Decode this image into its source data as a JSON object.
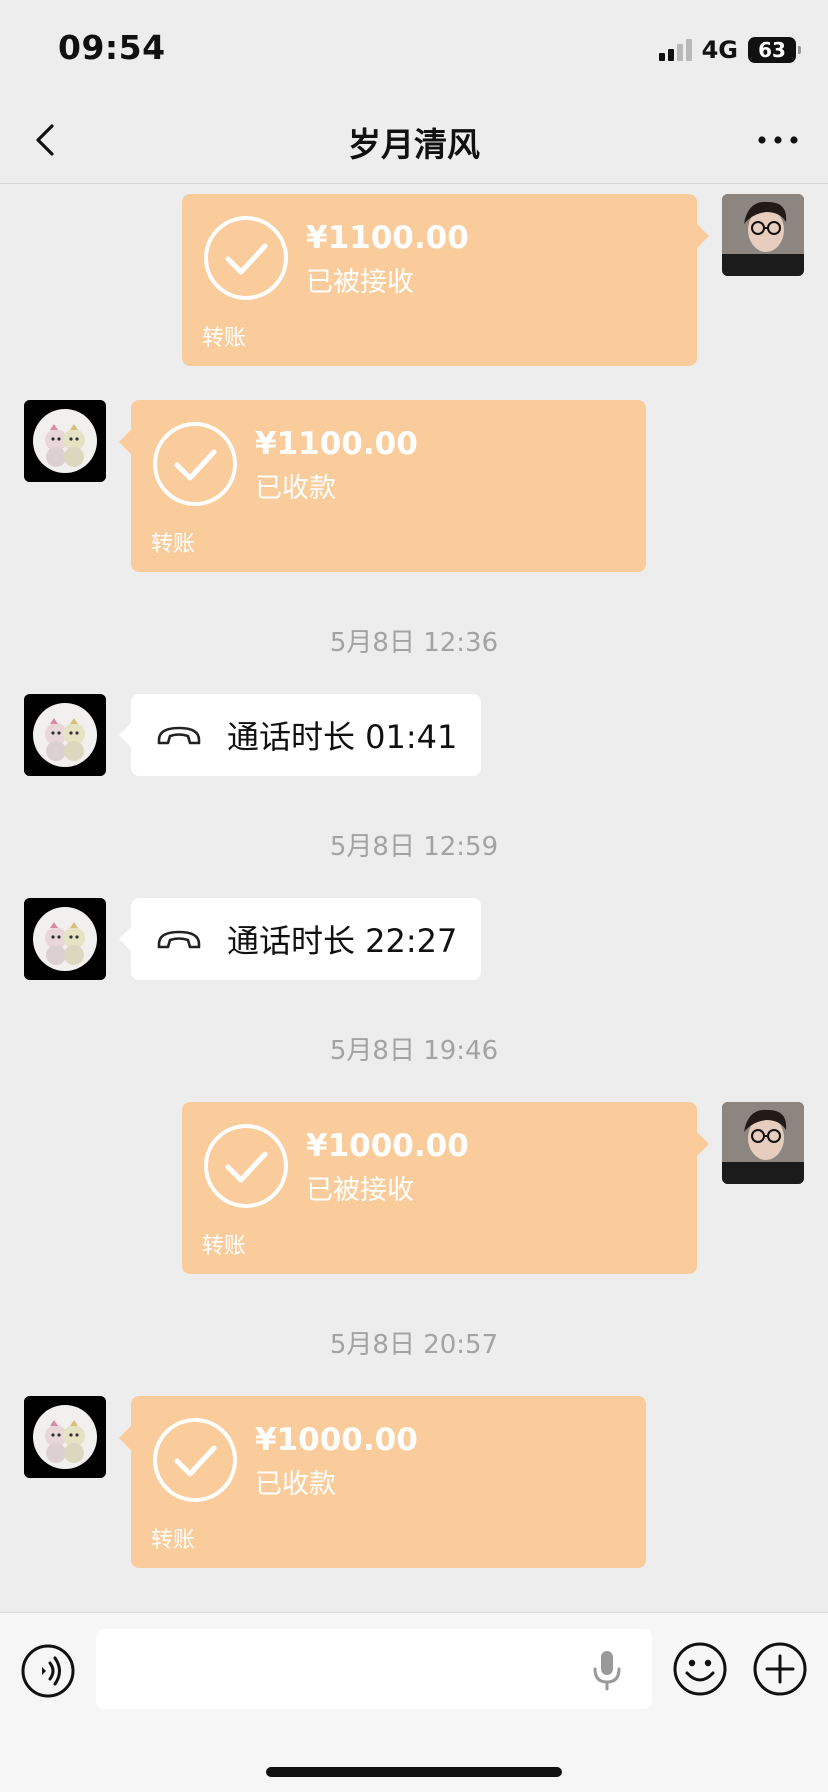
{
  "status_bar": {
    "time": "09:54",
    "network": "4G",
    "battery": "63"
  },
  "header": {
    "title": "岁月清风",
    "back_icon": "chevron-left-icon",
    "more_icon": "more-dots-icon"
  },
  "messages": [
    {
      "type": "transfer",
      "side": "right",
      "amount": "¥1100.00",
      "status": "已被接收",
      "label": "转账"
    },
    {
      "type": "transfer",
      "side": "left",
      "amount": "¥1100.00",
      "status": "已收款",
      "label": "转账"
    },
    {
      "type": "timestamp",
      "text": "5月8日 12:36"
    },
    {
      "type": "call",
      "side": "left",
      "text": "通话时长 01:41"
    },
    {
      "type": "timestamp",
      "text": "5月8日 12:59"
    },
    {
      "type": "call",
      "side": "left",
      "text": "通话时长 22:27"
    },
    {
      "type": "timestamp",
      "text": "5月8日 19:46"
    },
    {
      "type": "transfer",
      "side": "right",
      "amount": "¥1000.00",
      "status": "已被接收",
      "label": "转账"
    },
    {
      "type": "timestamp",
      "text": "5月8日 20:57"
    },
    {
      "type": "transfer",
      "side": "left",
      "amount": "¥1000.00",
      "status": "已收款",
      "label": "转账"
    }
  ],
  "input_bar": {
    "value": "",
    "placeholder": "",
    "icons": [
      "voice-icon",
      "mic-icon",
      "emoji-icon",
      "plus-icon"
    ]
  },
  "colors": {
    "background": "#ededed",
    "transfer_bubble": "#fbcc9b",
    "call_bubble": "#ffffff",
    "timestamp_text": "#a3a3a3"
  }
}
